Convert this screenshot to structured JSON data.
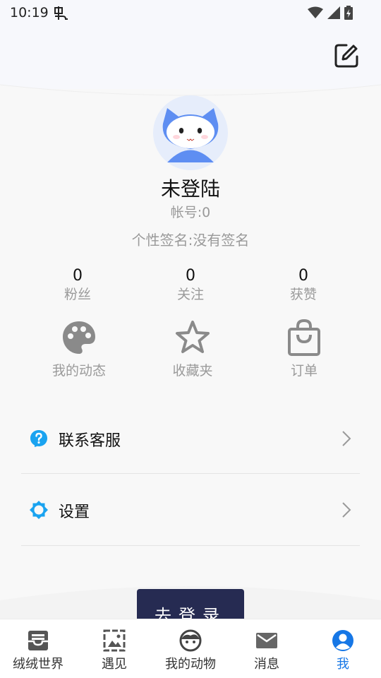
{
  "status_bar": {
    "time": "10:19"
  },
  "profile": {
    "name": "未登陆",
    "account": "帐号:0",
    "signature": "个性签名:没有签名"
  },
  "stats": [
    {
      "value": "0",
      "label": "粉丝"
    },
    {
      "value": "0",
      "label": "关注"
    },
    {
      "value": "0",
      "label": "获赞"
    }
  ],
  "quick_actions": [
    {
      "label": "我的动态",
      "icon": "palette-icon"
    },
    {
      "label": "收藏夹",
      "icon": "star-icon"
    },
    {
      "label": "订单",
      "icon": "shopping-bag-icon"
    }
  ],
  "menu": [
    {
      "label": "联系客服",
      "icon": "help-icon"
    },
    {
      "label": "设置",
      "icon": "gear-icon"
    }
  ],
  "login_button": {
    "label": "去登录"
  },
  "bottom_nav": [
    {
      "label": "绒绒世界",
      "icon": "inbox-icon",
      "active": false
    },
    {
      "label": "遇见",
      "icon": "gallery-icon",
      "active": false
    },
    {
      "label": "我的动物",
      "icon": "face-icon",
      "active": false
    },
    {
      "label": "消息",
      "icon": "mail-icon",
      "active": false
    },
    {
      "label": "我",
      "icon": "person-icon",
      "active": true
    }
  ],
  "colors": {
    "accent": "#1677e6",
    "menu_icon": "#1aa3f0",
    "login_bg": "#262b52",
    "avatar_blue": "#5e8ef2"
  }
}
